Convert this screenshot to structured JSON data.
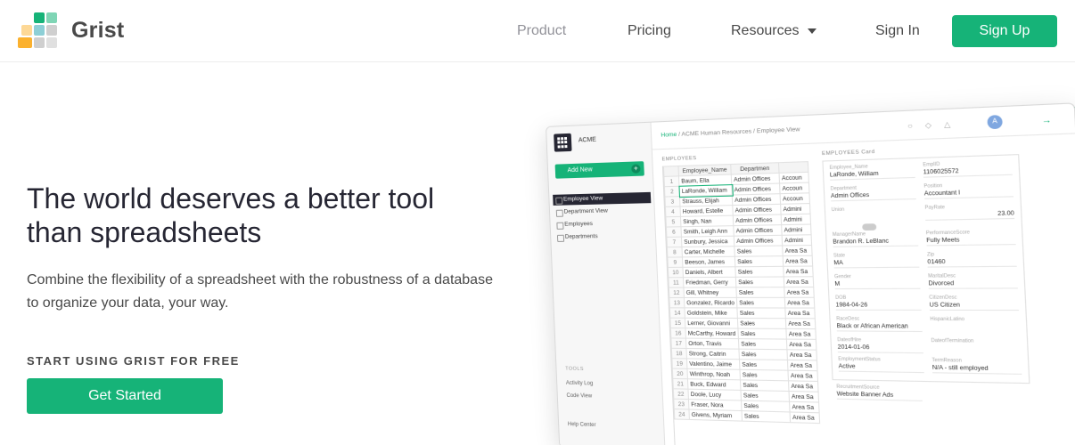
{
  "nav": {
    "brand": "Grist",
    "links": [
      "Product",
      "Pricing",
      "Resources",
      "Sign In"
    ],
    "signup": "Sign Up"
  },
  "colors": {
    "accent": "#16b378",
    "orange": "#fbb12e",
    "logo_tiles": [
      "#fbb12e",
      "#16b378",
      "#8dcfd6",
      "#c9c9c9",
      "#f4a261",
      "#16b378",
      "#d4d4d4",
      "#fbb12e",
      "#c9c9c9"
    ]
  },
  "hero": {
    "headline": "The world deserves a better tool than spreadsheets",
    "subtext": "Combine the flexibility of a spreadsheet with the robustness of a database to organize your data, your way.",
    "cta_title": "START USING GRIST FOR FREE",
    "cta_button": "Get Started"
  },
  "mockup": {
    "org": "ACME",
    "add_new": "Add New",
    "pages": [
      "Employee View",
      "Department View",
      "Employees",
      "Departments"
    ],
    "tools_title": "TOOLS",
    "tools": [
      "Activity Log",
      "Code View"
    ],
    "help": "Help Center",
    "breadcrumb_home": "Home",
    "breadcrumb_rest": "/ ACME Human Resources / Employee View",
    "avatar": "A",
    "grid_title": "EMPLOYEES",
    "grid_headers": [
      "Employee_Name",
      "Departmen",
      ""
    ],
    "rows": [
      {
        "n": "1",
        "name": "Baum, Ella",
        "dept": "Admin Offices",
        "acc": "Accoun"
      },
      {
        "n": "2",
        "name": "LaRonde, William",
        "dept": "Admin Offices",
        "acc": "Accoun"
      },
      {
        "n": "3",
        "name": "Strauss, Elijah",
        "dept": "Admin Offices",
        "acc": "Accoun"
      },
      {
        "n": "4",
        "name": "Howard, Estelle",
        "dept": "Admin Offices",
        "acc": "Admini"
      },
      {
        "n": "5",
        "name": "Singh, Nan",
        "dept": "Admin Offices",
        "acc": "Admini"
      },
      {
        "n": "6",
        "name": "Smith, Leigh Ann",
        "dept": "Admin Offices",
        "acc": "Admini"
      },
      {
        "n": "7",
        "name": "Sunbury, Jessica",
        "dept": "Admin Offices",
        "acc": "Admini"
      },
      {
        "n": "8",
        "name": "Carter, Michelle",
        "dept": "Sales",
        "acc": "Area Sa"
      },
      {
        "n": "9",
        "name": "Beeson, James",
        "dept": "Sales",
        "acc": "Area Sa"
      },
      {
        "n": "10",
        "name": "Daniels, Albert",
        "dept": "Sales",
        "acc": "Area Sa"
      },
      {
        "n": "11",
        "name": "Friedman, Gerry",
        "dept": "Sales",
        "acc": "Area Sa"
      },
      {
        "n": "12",
        "name": "Gill, Whitney",
        "dept": "Sales",
        "acc": "Area Sa"
      },
      {
        "n": "13",
        "name": "Gonzalez, Ricardo",
        "dept": "Sales",
        "acc": "Area Sa"
      },
      {
        "n": "14",
        "name": "Goldstein, Mike",
        "dept": "Sales",
        "acc": "Area Sa"
      },
      {
        "n": "15",
        "name": "Lerner, Giovanni",
        "dept": "Sales",
        "acc": "Area Sa"
      },
      {
        "n": "16",
        "name": "McCarthy, Howard",
        "dept": "Sales",
        "acc": "Area Sa"
      },
      {
        "n": "17",
        "name": "Orton, Travis",
        "dept": "Sales",
        "acc": "Area Sa"
      },
      {
        "n": "18",
        "name": "Strong, Caitrin",
        "dept": "Sales",
        "acc": "Area Sa"
      },
      {
        "n": "19",
        "name": "Valentino, Jaime",
        "dept": "Sales",
        "acc": "Area Sa"
      },
      {
        "n": "20",
        "name": "Winthrop, Noah",
        "dept": "Sales",
        "acc": "Area Sa"
      },
      {
        "n": "21",
        "name": "Buck, Edward",
        "dept": "Sales",
        "acc": "Area Sa"
      },
      {
        "n": "22",
        "name": "Doole, Lucy",
        "dept": "Sales",
        "acc": "Area Sa"
      },
      {
        "n": "23",
        "name": "Fraser, Nora",
        "dept": "Sales",
        "acc": "Area Sa"
      },
      {
        "n": "24",
        "name": "Givens, Myriam",
        "dept": "Sales",
        "acc": "Area Sa"
      }
    ],
    "card_title": "EMPLOYEES Card",
    "card": {
      "employee_name_label": "Employee_Name",
      "employee_name": "LaRonde, William",
      "emplid_label": "EmplID",
      "emplid": "1106025572",
      "department_label": "Department",
      "department": "Admin Offices",
      "position_label": "Position",
      "position": "Accountant I",
      "union_label": "Union",
      "payrate_label": "PayRate",
      "payrate": "23.00",
      "manager_label": "ManagerName",
      "manager": "Brandon R. LeBlanc",
      "perf_label": "PerformanceScore",
      "perf": "Fully Meets",
      "state_label": "State",
      "state": "MA",
      "zip_label": "Zip",
      "zip": "01460",
      "gender_label": "Gender",
      "gender": "M",
      "marital_label": "MaritalDesc",
      "marital": "Divorced",
      "dob_label": "DOB",
      "dob": "1984-04-26",
      "citizen_label": "CitizenDesc",
      "citizen": "US Citizen",
      "race_label": "RaceDesc",
      "race": "Black or African American",
      "hispanic_label": "HispanicLatino",
      "hire_label": "DateofHire",
      "hire": "2014-01-06",
      "term_label": "DateofTermination",
      "status_label": "EmploymentStatus",
      "status": "Active",
      "termreason_label": "TermReason",
      "termreason": "N/A - still employed",
      "source_label": "RecruitmentSource",
      "source": "Website Banner Ads"
    }
  }
}
